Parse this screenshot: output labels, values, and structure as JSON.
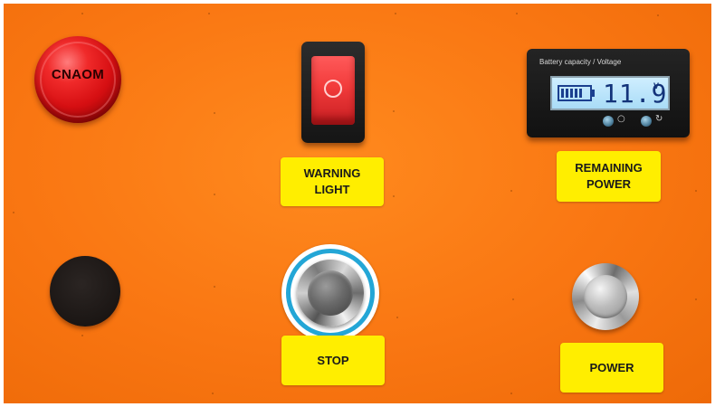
{
  "panel": {
    "background_color": "#f97612",
    "lamp": {
      "label": "CNAOM",
      "color": "#d60f12",
      "icon": "red-indicator-lamp"
    },
    "rocker_switch": {
      "color": "#f23b3b",
      "icon": "power-ring-symbol"
    },
    "battery_meter": {
      "caption": "Battery capacity / Voltage",
      "voltage": "11.9",
      "unit": "V",
      "charge_level": 0.75,
      "lcd_color": "#a9dcf7",
      "buttons": [
        "meter-power-button",
        "meter-mode-button"
      ],
      "glyphs": [
        "○",
        "↻"
      ]
    },
    "labels": {
      "warning": [
        "WARNING",
        "LIGHT"
      ],
      "remaining": [
        "REMAINING",
        "POWER"
      ],
      "stop": "STOP",
      "power": "POWER"
    },
    "label_color": "#ffee00",
    "highlight_ring_color": "#23a6d6"
  }
}
